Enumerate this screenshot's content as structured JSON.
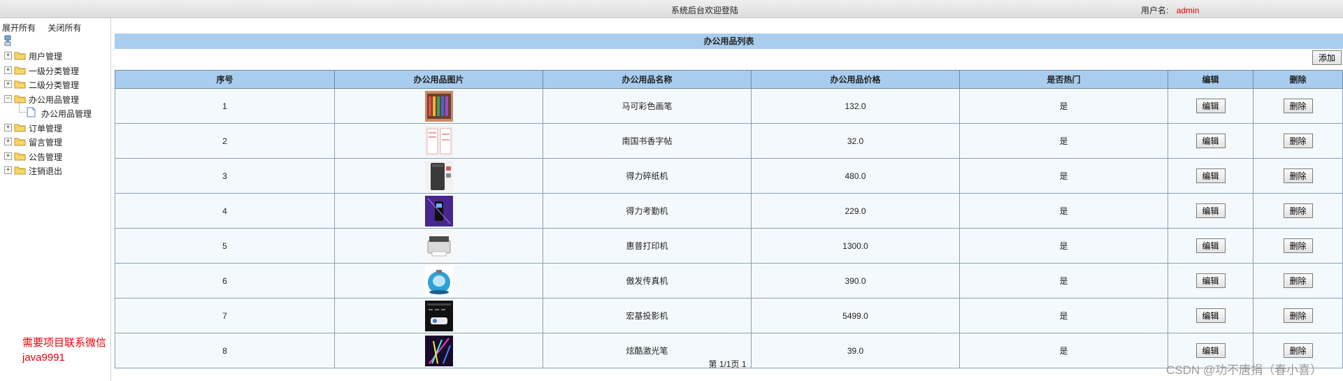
{
  "header": {
    "welcome": "系统后台欢迎登陆",
    "user_label": "用户名:",
    "user_name": "admin"
  },
  "sidebar": {
    "expand_all": "展开所有",
    "collapse_all": "关闭所有",
    "tree": [
      {
        "label": "用户管理",
        "expanded": false
      },
      {
        "label": "一级分类管理",
        "expanded": false
      },
      {
        "label": "二级分类管理",
        "expanded": false
      },
      {
        "label": "办公用品管理",
        "expanded": true,
        "children": [
          "办公用品管理"
        ]
      },
      {
        "label": "订单管理",
        "expanded": false
      },
      {
        "label": "留言管理",
        "expanded": false
      },
      {
        "label": "公告管理",
        "expanded": false
      },
      {
        "label": "注销退出",
        "expanded": false
      }
    ],
    "note": "需要项目联系微信java9991"
  },
  "main": {
    "title": "办公用品列表",
    "add_label": "添加",
    "columns": [
      "序号",
      "办公用品图片",
      "办公用品名称",
      "办公用品价格",
      "是否热门",
      "编辑",
      "删除"
    ],
    "edit_label": "编辑",
    "delete_label": "删除",
    "rows": [
      {
        "no": "1",
        "name": "马可彩色画笔",
        "price": "132.0",
        "hot": "是",
        "thumb": "colored-pencils"
      },
      {
        "no": "2",
        "name": "南国书香字帖",
        "price": "32.0",
        "hot": "是",
        "thumb": "copybook"
      },
      {
        "no": "3",
        "name": "得力碎纸机",
        "price": "480.0",
        "hot": "是",
        "thumb": "shredder"
      },
      {
        "no": "4",
        "name": "得力考勤机",
        "price": "229.0",
        "hot": "是",
        "thumb": "attendance-machine"
      },
      {
        "no": "5",
        "name": "惠普打印机",
        "price": "1300.0",
        "hot": "是",
        "thumb": "printer"
      },
      {
        "no": "6",
        "name": "傲发传真机",
        "price": "390.0",
        "hot": "是",
        "thumb": "fax-machine"
      },
      {
        "no": "7",
        "name": "宏基投影机",
        "price": "5499.0",
        "hot": "是",
        "thumb": "projector"
      },
      {
        "no": "8",
        "name": "炫酷激光笔",
        "price": "39.0",
        "hot": "是",
        "thumb": "laser-pointer"
      }
    ],
    "pager": "第 1/1页 1"
  },
  "watermark": "CSDN @功不唐捐（春小喜）",
  "colors": {
    "header_blue": "#a9cdee",
    "row_bg": "#f4f9fd",
    "note_red": "#e8000a",
    "user_red": "#e00000"
  }
}
